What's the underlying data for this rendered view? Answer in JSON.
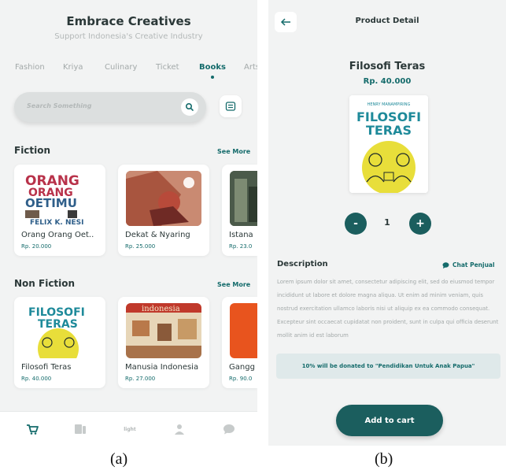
{
  "screen_a": {
    "title": "Embrace Creatives",
    "subtitle": "Support Indonesia's Creative Industry",
    "tabs": [
      "Fashion",
      "Kriya",
      "Culinary",
      "Ticket",
      "Books",
      "Arts"
    ],
    "active_tab": "Books",
    "search_placeholder": "Search Something",
    "sections": [
      {
        "title": "Fiction",
        "see_more": "See More",
        "books": [
          {
            "name": "Orang Orang Oet..",
            "price": "Rp. 20.000"
          },
          {
            "name": "Dekat & Nyaring",
            "price": "Rp. 25.000"
          },
          {
            "name": "Istana",
            "price": "Rp. 23.0"
          }
        ]
      },
      {
        "title": "Non Fiction",
        "see_more": "See More",
        "books": [
          {
            "name": "Filosofi Teras",
            "price": "Rp. 40.000"
          },
          {
            "name": "Manusia Indonesia",
            "price": "Rp. 27.000"
          },
          {
            "name": "Gangg",
            "price": "Rp. 90.0"
          }
        ]
      }
    ],
    "cover_text": {
      "orang_line1": "ORANG",
      "orang_line2": "ORANG",
      "orang_line3": "OETIMU",
      "orang_author": "FELIX K. NESI",
      "filosofi_line1": "FILOSOFI",
      "filosofi_line2": "TERAS",
      "manusia_title": "indonesia"
    },
    "nav": {
      "cart_icon": "cart-icon",
      "catalog_icon": "catalog-icon",
      "center_label": "light",
      "profile_icon": "profile-icon",
      "chat_icon": "chat-icon"
    }
  },
  "screen_b": {
    "header": "Product Detail",
    "product_name": "Filosofi Teras",
    "price": "Rp. 40.000",
    "cover_author": "HENRY MANAMPIRING",
    "cover_title_1": "FILOSOFI",
    "cover_title_2": "TERAS",
    "quantity": "1",
    "minus_label": "-",
    "plus_label": "+",
    "description_title": "Description",
    "chat_label": "Chat Penjual",
    "description": "Lorem ipsum dolor sit amet, consectetur adipiscing elit, sed do eiusmod tempor incididunt ut labore et dolore magna aliqua. Ut enim ad minim veniam, quis nostrud exercitation ullamco laboris nisi ut aliquip ex ea commodo consequat. Excepteur sint occaecat cupidatat non proident, sunt in culpa qui officia deserunt mollit anim id est laborum",
    "donation": "10% will be donated to \"Pendidikan Untuk Anak Papua\"",
    "add_to_cart": "Add to cart"
  },
  "captions": {
    "a": "(a)",
    "b": "(b)"
  },
  "colors": {
    "accent": "#146b6b",
    "button": "#1b5e5e",
    "background": "#f2f3f3"
  }
}
